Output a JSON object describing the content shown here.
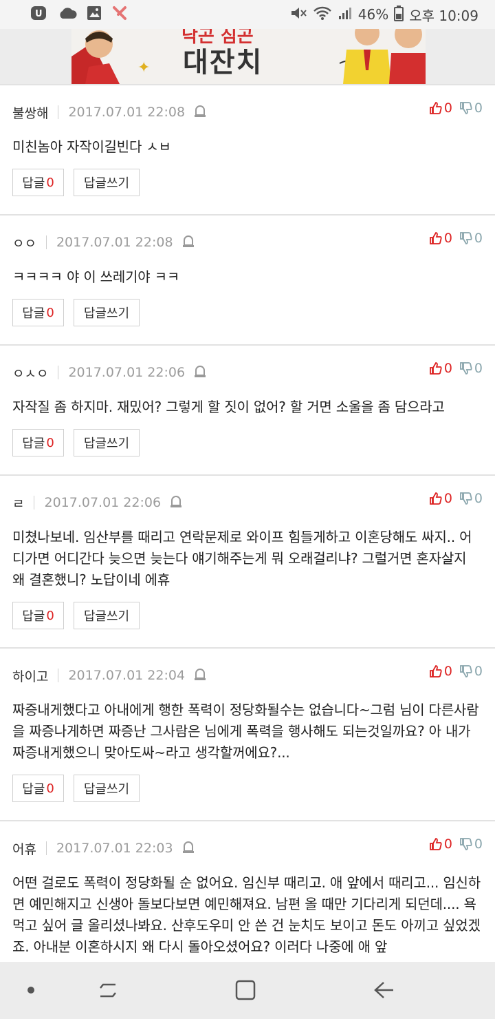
{
  "status_bar": {
    "battery": "46%",
    "time": "오후 10:09"
  },
  "banner": {
    "title": "대잔치",
    "top_text": "낙곤 심곤"
  },
  "comments": [
    {
      "author": "불쌍해",
      "date": "2017.07.01 22:08",
      "body": "미친놈아 자작이길빈다 ㅅㅂ",
      "up": "0",
      "down": "0",
      "reply_label": "답글",
      "reply_count": "0",
      "write_label": "답글쓰기"
    },
    {
      "author": "ㅇㅇ",
      "date": "2017.07.01 22:08",
      "body": "ㅋㅋㅋㅋ 야 이 쓰레기야 ㅋㅋ",
      "up": "0",
      "down": "0",
      "reply_label": "답글",
      "reply_count": "0",
      "write_label": "답글쓰기"
    },
    {
      "author": "ㅇㅅㅇ",
      "date": "2017.07.01 22:06",
      "body": "자작질 좀 하지마. 재밌어? 그렇게 할 짓이 없어? 할 거면 소울을 좀 담으라고",
      "up": "0",
      "down": "0",
      "reply_label": "답글",
      "reply_count": "0",
      "write_label": "답글쓰기"
    },
    {
      "author": "ㄹ",
      "date": "2017.07.01 22:06",
      "body": "미쳤나보네. 임산부를 때리고 연락문제로 와이프 힘들게하고 이혼당해도 싸지.. 어디가면 어디간다 늦으면 늦는다 얘기해주는게 뭐 오래걸리냐? 그럴거면 혼자살지 왜 결혼했니? 노답이네 에휴",
      "up": "0",
      "down": "0",
      "reply_label": "답글",
      "reply_count": "0",
      "write_label": "답글쓰기"
    },
    {
      "author": "하이고",
      "date": "2017.07.01 22:04",
      "body": "짜증내게했다고 아내에게 행한 폭력이 정당화될수는 없습니다~그럼 님이 다른사람을 짜증나게하면 짜증난 그사람은 님에게 폭력을 행사해도 되는것일까요? 아 내가 짜증내게했으니 맞아도싸~라고 생각할꺼에요?...",
      "up": "0",
      "down": "0",
      "reply_label": "답글",
      "reply_count": "0",
      "write_label": "답글쓰기"
    },
    {
      "author": "어휴",
      "date": "2017.07.01 22:03",
      "body": "어떤 걸로도 폭력이 정당화될 순 없어요. 임신부 때리고. 애 앞에서 때리고... 임신하면 예민해지고 신생아 돌보다보면 예민해져요. 남편 올 때만 기다리게 되던데.... 욕 먹고 싶어 글 올리셨나봐요. 산후도우미 안 쓴 건 눈치도 보이고 돈도 아끼고 싶었겠죠. 아내분 이혼하시지 왜 다시 돌아오셨어요? 이러다 나중에 애 앞",
      "up": "0",
      "down": "0",
      "reply_label": "답글",
      "reply_count": "0",
      "write_label": "답글쓰기"
    }
  ],
  "colors": {
    "accent_red": "#dd2222",
    "dislike_gray": "#8aa6ad"
  }
}
